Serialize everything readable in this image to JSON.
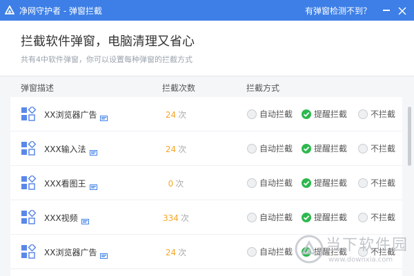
{
  "titlebar": {
    "title": "净网守护者 - 弹窗拦截",
    "help_link": "有弹窗检测不到？",
    "bg_color": "#3d7fe6"
  },
  "header": {
    "heading": "拦截软件弹窗，电脑清理又省心",
    "subheading": "共有4中软件弹窗，你可以设置每种弹窗的拦截方式"
  },
  "table": {
    "columns": [
      "弹窗描述",
      "拦截次数",
      "拦截方式"
    ],
    "options": [
      "自动拦截",
      "提醒拦截",
      "不拦截"
    ],
    "count_unit": "次",
    "rows": [
      {
        "name": "XX浏览器广告",
        "count": "24",
        "selected": "提醒拦截"
      },
      {
        "name": "XXX输入法",
        "count": "24",
        "selected": "提醒拦截"
      },
      {
        "name": "XXX看图王",
        "count": "0",
        "selected": "提醒拦截"
      },
      {
        "name": "XXX视频",
        "count": "334",
        "selected": "提醒拦截"
      },
      {
        "name": "XX浏览器广告",
        "count": "24",
        "selected": "提醒拦截"
      }
    ]
  },
  "watermark": {
    "title": "当下软件园",
    "url": "www.downxia.com"
  },
  "colors": {
    "accent": "#3d7fe6",
    "count": "#f5a623",
    "checked": "#2db84d"
  }
}
